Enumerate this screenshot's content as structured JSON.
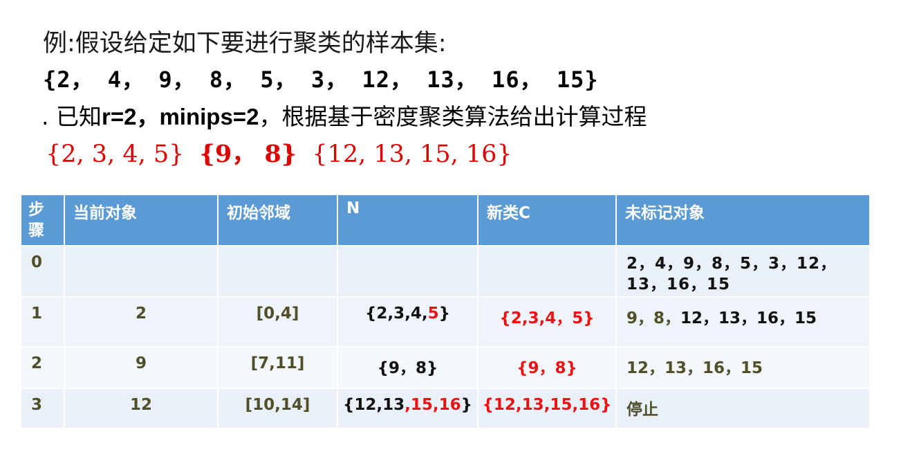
{
  "heading": {
    "line1": "例:假设给定如下要进行聚类的样本集:",
    "line2": "{2， 4， 9， 8， 5， 3， 12， 13， 16， 15}",
    "line3_prefix": ". 已知",
    "line3_bold": "r=2，minips=2",
    "line3_suffix": "，根据基于密度聚类算法给出计算过程",
    "clusters": [
      "{2, 3, 4, 5}",
      "{9， 8}",
      "{12, 13, 15, 16}"
    ]
  },
  "table": {
    "headers": [
      "步骤",
      "当前对象",
      "初始邻域",
      "N",
      "新类C",
      "未标记对象"
    ],
    "rows": [
      {
        "step": "0",
        "obj": "",
        "nbr": "",
        "n_a": "",
        "n_b": "",
        "c": "",
        "unmarked_a": "",
        "unmarked_b": "2，4，9，8，5，3，12，13，16，15"
      },
      {
        "step": "1",
        "obj": "2",
        "nbr": "[0,4]",
        "n_a": "{2,3,4,",
        "n_b": "5",
        "n_c": "}",
        "c": "{2,3,4，5}",
        "unmarked_a": "9，8，",
        "unmarked_b": "12，13，16，15"
      },
      {
        "step": "2",
        "obj": "9",
        "nbr": "[7,11]",
        "n_a": "{9，8}",
        "n_b": "",
        "n_c": "",
        "c": "{9，8}",
        "unmarked_a": "12，13，16，15",
        "unmarked_b": ""
      },
      {
        "step": "3",
        "obj": "12",
        "nbr": "[10,14]",
        "n_a": "{12,13",
        "n_b": ",15,16",
        "n_c": "}",
        "c": "{12,13,15,16}",
        "unmarked_a": "停止",
        "unmarked_b": ""
      }
    ]
  },
  "colors": {
    "header_bg": "#5b9bd5",
    "row_bg": "#e9f0f8",
    "highlight": "#ee1111",
    "olive_text": "#4f4f2a"
  }
}
